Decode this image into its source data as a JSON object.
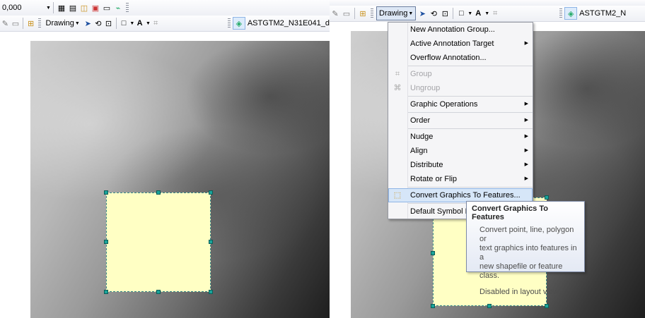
{
  "left": {
    "scale_value": "0,000",
    "drawing_label": "Drawing",
    "layer_name": "ASTGTM2_N31E041_d"
  },
  "right": {
    "drawing_label": "Drawing",
    "layer_name": "ASTGTM2_N",
    "menu": {
      "items": [
        {
          "label": "New Annotation Group...",
          "enabled": true,
          "submenu": false
        },
        {
          "label": "Active Annotation Target",
          "enabled": true,
          "submenu": true
        },
        {
          "label": "Overflow Annotation...",
          "enabled": true,
          "submenu": false
        },
        {
          "label": "Group",
          "enabled": false,
          "submenu": false,
          "icon": "group-icon"
        },
        {
          "label": "Ungroup",
          "enabled": false,
          "submenu": false,
          "icon": "ungroup-icon"
        },
        {
          "label": "Graphic Operations",
          "enabled": true,
          "submenu": true
        },
        {
          "label": "Order",
          "enabled": true,
          "submenu": true
        },
        {
          "label": "Nudge",
          "enabled": true,
          "submenu": true
        },
        {
          "label": "Align",
          "enabled": true,
          "submenu": true
        },
        {
          "label": "Distribute",
          "enabled": true,
          "submenu": true
        },
        {
          "label": "Rotate or Flip",
          "enabled": true,
          "submenu": true
        },
        {
          "label": "Convert Graphics To Features...",
          "enabled": true,
          "submenu": false,
          "highlighted": true,
          "icon": "convert-graphics-icon"
        },
        {
          "label": "Default Symbol P",
          "enabled": true,
          "submenu": false
        }
      ]
    },
    "tooltip": {
      "title": "Convert Graphics To Features",
      "body": [
        "Convert point, line, polygon or",
        "text graphics into features in a",
        "new shapefile or feature class."
      ],
      "note": "Disabled in layout view."
    }
  },
  "colors": {
    "graphic_fill": "#ffffc4",
    "handle": "#1aa39a",
    "menu_highlight": "#d6e6f8",
    "background": "#e8e4ee"
  }
}
